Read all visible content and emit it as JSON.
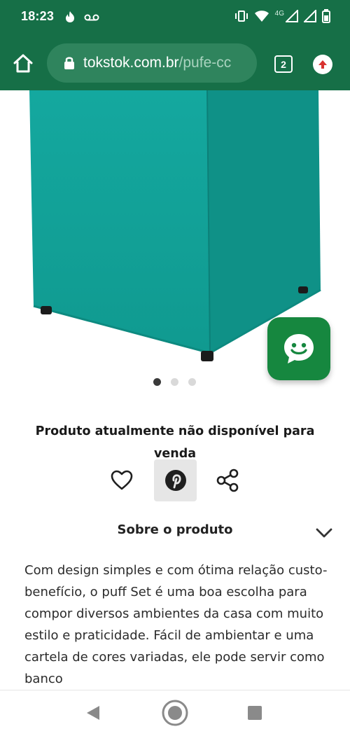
{
  "status_bar": {
    "time": "18:23",
    "network": "4G",
    "colors": {
      "background": "#166f47"
    }
  },
  "browser": {
    "url_domain": "tokstok.com.br",
    "url_path": "/pufe-cc",
    "tab_count": "2"
  },
  "product": {
    "image_alt": "pufe-turquoise-cube",
    "carousel": {
      "total": 3,
      "active_index": 0
    },
    "unavailable_text": "Produto atualmente não disponível para venda",
    "colors": {
      "pouf": "#12a39a",
      "accent": "#16873f"
    }
  },
  "actions": {
    "favorite_icon": "heart-icon",
    "pinterest_icon": "pinterest-icon",
    "share_icon": "share-icon"
  },
  "about": {
    "title": "Sobre o produto",
    "description": "Com design simples e com ótima relação custo-benefício, o puff Set é uma boa escolha para compor diversos ambientes da casa com muito estilo e praticidade. Fácil de ambientar e uma cartela de cores variadas, ele pode servir como banco"
  },
  "nav": {
    "back_icon": "back-triangle-icon",
    "home_icon": "home-circle-icon",
    "recents_icon": "recents-square-icon"
  }
}
